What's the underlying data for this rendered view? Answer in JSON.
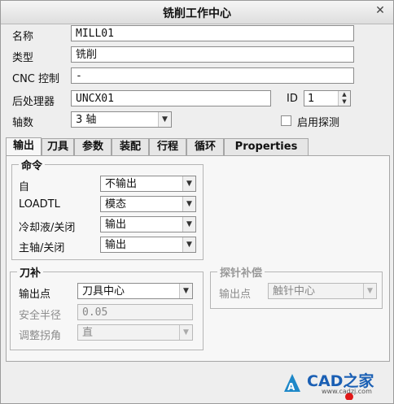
{
  "window": {
    "title": "铣削工作中心"
  },
  "form": {
    "name_label": "名称",
    "name_value": "MILL01",
    "type_label": "类型",
    "type_value": "铣削",
    "cnc_label": "CNC 控制",
    "cnc_value": "-",
    "post_label": "后处理器",
    "post_value": "UNCX01",
    "id_label": "ID",
    "id_value": "1",
    "axes_label": "轴数",
    "axes_value": "3 轴",
    "probe_label": "启用探测",
    "probe_checked": false
  },
  "tabs": [
    "输出",
    "刀具",
    "参数",
    "装配",
    "行程",
    "循环",
    "Properties"
  ],
  "commands": {
    "title": "命令",
    "rows": [
      {
        "label": "自",
        "value": "不输出"
      },
      {
        "label": "LOADTL",
        "value": "模态"
      },
      {
        "label": "冷却液/关闭",
        "value": "输出"
      },
      {
        "label": "主轴/关闭",
        "value": "输出"
      }
    ]
  },
  "cutter_comp": {
    "title": "刀补",
    "output_point_label": "输出点",
    "output_point_value": "刀具中心",
    "safe_radius_label": "安全半径",
    "safe_radius_value": "0.05",
    "adjust_corner_label": "调整拐角",
    "adjust_corner_value": "直"
  },
  "probe_comp": {
    "title": "探针补偿",
    "output_point_label": "输出点",
    "output_point_value": "触针中心"
  },
  "watermark": {
    "text": "CAD之家",
    "url": "www.cadzj.com"
  }
}
